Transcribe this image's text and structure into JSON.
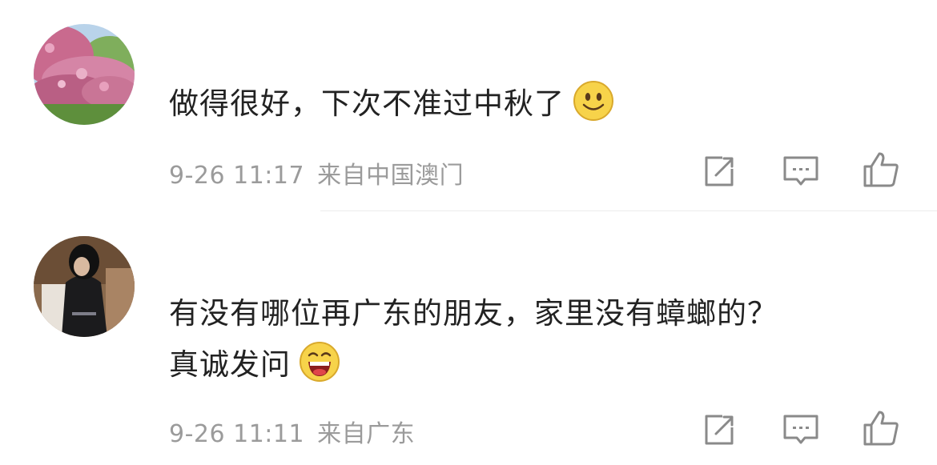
{
  "comments": [
    {
      "text": "做得很好，下次不准过中秋了",
      "emoji": "smile-emoji",
      "time": "9-26 11:17",
      "source": "来自中国澳门",
      "avatar": "avatar-flowers",
      "actions": [
        "share-icon",
        "comment-icon",
        "like-icon"
      ]
    },
    {
      "text_line1": "有没有哪位再广东的朋友，家里没有蟑螂的？",
      "text_line2": "真诚发问",
      "emoji": "laugh-emoji",
      "time": "9-26 11:11",
      "source": "来自广东",
      "avatar": "avatar-person",
      "actions": [
        "share-icon",
        "comment-icon",
        "like-icon"
      ]
    }
  ],
  "colors": {
    "text": "#222222",
    "meta": "#9b9b9b",
    "icon": "#8a8a8a",
    "divider": "#ececec"
  }
}
